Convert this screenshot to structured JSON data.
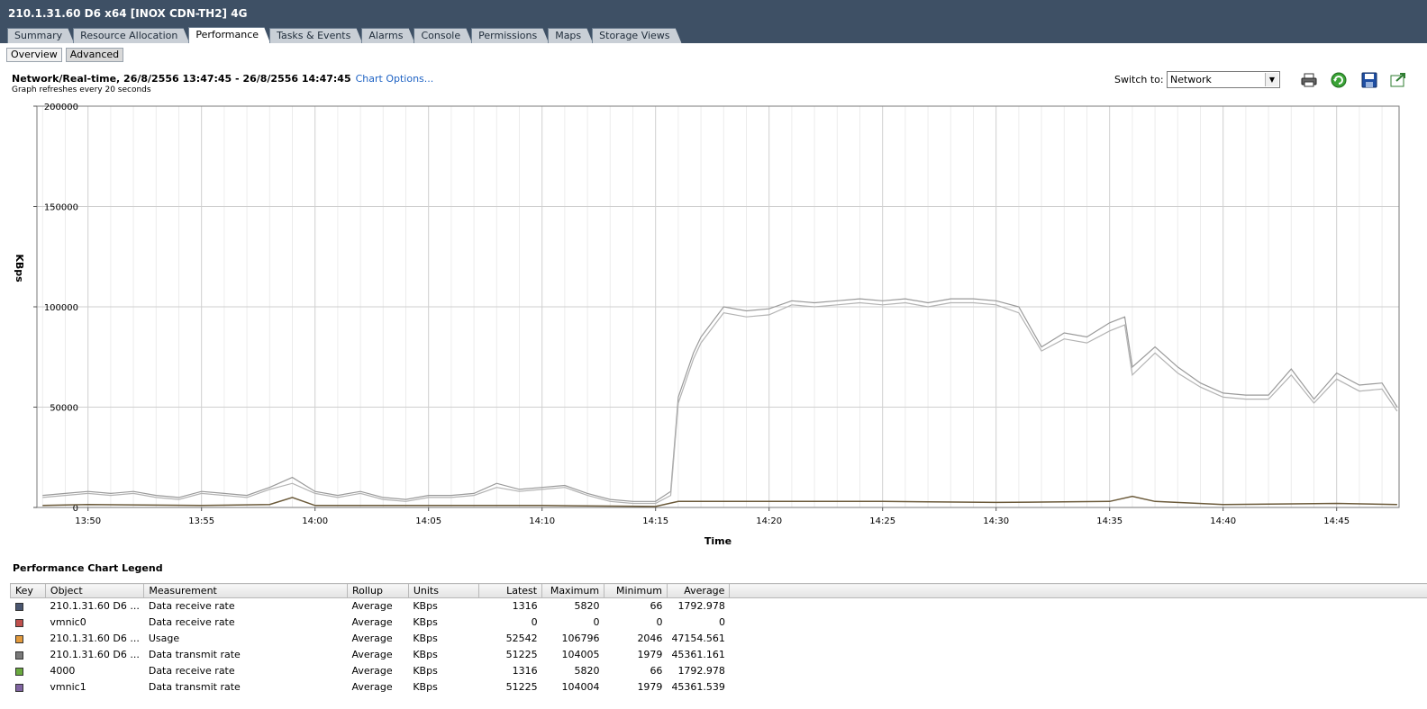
{
  "window": {
    "title": "210.1.31.60 D6 x64 [INOX CDN-TH2] 4G"
  },
  "tabs": [
    {
      "label": "Summary",
      "active": false
    },
    {
      "label": "Resource Allocation",
      "active": false
    },
    {
      "label": "Performance",
      "active": true
    },
    {
      "label": "Tasks & Events",
      "active": false
    },
    {
      "label": "Alarms",
      "active": false
    },
    {
      "label": "Console",
      "active": false
    },
    {
      "label": "Permissions",
      "active": false
    },
    {
      "label": "Maps",
      "active": false
    },
    {
      "label": "Storage Views",
      "active": false
    }
  ],
  "subtabs": {
    "overview": "Overview",
    "advanced": "Advanced"
  },
  "chart_header": {
    "title": "Network/Real-time, 26/8/2556 13:47:45 - 26/8/2556 14:47:45",
    "options_link": "Chart Options...",
    "refresh_note": "Graph refreshes every 20 seconds"
  },
  "switch_to": {
    "label": "Switch to:",
    "value": "Network"
  },
  "toolbar_icons": [
    "print-icon",
    "refresh-icon",
    "save-icon",
    "export-icon"
  ],
  "chart_data": {
    "type": "line",
    "title": "",
    "xlabel": "Time",
    "ylabel": "KBps",
    "ylim": [
      0,
      200000
    ],
    "yticks": [
      0,
      50000,
      100000,
      150000,
      200000
    ],
    "xlim": [
      "13:47:45",
      "14:47:45"
    ],
    "xticks": [
      "13:50",
      "13:55",
      "14:00",
      "14:05",
      "14:10",
      "14:15",
      "14:20",
      "14:25",
      "14:30",
      "14:35",
      "14:40",
      "14:45"
    ],
    "grid": true,
    "series": [
      {
        "color": "#9a9a9a",
        "x": [
          "13:48",
          "13:49",
          "13:50",
          "13:51",
          "13:52",
          "13:53",
          "13:54",
          "13:55",
          "13:56",
          "13:57",
          "13:58",
          "13:59",
          "14:00",
          "14:01",
          "14:02",
          "14:03",
          "14:04",
          "14:05",
          "14:06",
          "14:07",
          "14:08",
          "14:09",
          "14:10",
          "14:11",
          "14:12",
          "14:13",
          "14:14",
          "14:15",
          "14:15:40",
          "14:16",
          "14:16:40",
          "14:17",
          "14:18",
          "14:19",
          "14:20",
          "14:21",
          "14:22",
          "14:23",
          "14:24",
          "14:25",
          "14:26",
          "14:27",
          "14:28",
          "14:29",
          "14:30",
          "14:31",
          "14:32",
          "14:33",
          "14:34",
          "14:35",
          "14:35:40",
          "14:36",
          "14:37",
          "14:38",
          "14:39",
          "14:40",
          "14:41",
          "14:42",
          "14:43",
          "14:44",
          "14:45",
          "14:46",
          "14:47",
          "14:47:40"
        ],
        "values": [
          6000,
          7000,
          8000,
          7000,
          8000,
          6000,
          5000,
          8000,
          7000,
          6000,
          10000,
          15000,
          8000,
          6000,
          8000,
          5000,
          4000,
          6000,
          6000,
          7000,
          12000,
          9000,
          10000,
          11000,
          7000,
          4000,
          3000,
          3000,
          8000,
          55000,
          77000,
          85000,
          100000,
          98000,
          99000,
          103000,
          102000,
          103000,
          104000,
          103000,
          104000,
          102000,
          104000,
          104000,
          103000,
          100000,
          80000,
          87000,
          85000,
          92000,
          95000,
          70000,
          80000,
          70000,
          62000,
          57000,
          56000,
          56000,
          69000,
          54000,
          67000,
          61000,
          62000,
          50000
        ]
      },
      {
        "color": "#b3b3b3",
        "x": [
          "13:48",
          "13:49",
          "13:50",
          "13:51",
          "13:52",
          "13:53",
          "13:54",
          "13:55",
          "13:56",
          "13:57",
          "13:58",
          "13:59",
          "14:00",
          "14:01",
          "14:02",
          "14:03",
          "14:04",
          "14:05",
          "14:06",
          "14:07",
          "14:08",
          "14:09",
          "14:10",
          "14:11",
          "14:12",
          "14:13",
          "14:14",
          "14:15",
          "14:15:40",
          "14:16",
          "14:16:40",
          "14:17",
          "14:18",
          "14:19",
          "14:20",
          "14:21",
          "14:22",
          "14:23",
          "14:24",
          "14:25",
          "14:26",
          "14:27",
          "14:28",
          "14:29",
          "14:30",
          "14:31",
          "14:32",
          "14:33",
          "14:34",
          "14:35",
          "14:35:40",
          "14:36",
          "14:37",
          "14:38",
          "14:39",
          "14:40",
          "14:41",
          "14:42",
          "14:43",
          "14:44",
          "14:45",
          "14:46",
          "14:47",
          "14:47:40"
        ],
        "values": [
          5000,
          6000,
          7000,
          6000,
          7000,
          5000,
          4000,
          7000,
          6000,
          5000,
          9000,
          12000,
          7000,
          5000,
          7000,
          4000,
          3000,
          5000,
          5000,
          6000,
          10000,
          8000,
          9000,
          10000,
          6000,
          3000,
          2000,
          2000,
          6000,
          52000,
          74000,
          82000,
          97000,
          95000,
          96000,
          101000,
          100000,
          101000,
          102000,
          101000,
          102000,
          100000,
          102000,
          102000,
          101000,
          97000,
          78000,
          84000,
          82000,
          88000,
          91000,
          66000,
          77000,
          67000,
          60000,
          55000,
          54000,
          54000,
          66000,
          52000,
          64000,
          58000,
          59000,
          48000
        ]
      },
      {
        "color": "#6b5a3a",
        "x": [
          "13:48",
          "13:50",
          "13:55",
          "13:58",
          "13:59",
          "14:00",
          "14:05",
          "14:10",
          "14:15",
          "14:16",
          "14:20",
          "14:25",
          "14:30",
          "14:35",
          "14:36",
          "14:37",
          "14:40",
          "14:45",
          "14:47:40"
        ],
        "values": [
          1000,
          1500,
          1000,
          1500,
          5000,
          1000,
          1000,
          1000,
          500,
          3000,
          3000,
          3000,
          2500,
          3000,
          5500,
          3000,
          1500,
          2000,
          1500
        ]
      }
    ]
  },
  "legend": {
    "title": "Performance Chart Legend",
    "columns": [
      "Key",
      "Object",
      "Measurement",
      "Rollup",
      "Units",
      "Latest",
      "Maximum",
      "Minimum",
      "Average"
    ],
    "rows": [
      {
        "color": "#4a5670",
        "object": "210.1.31.60 D6 ...",
        "measurement": "Data receive rate",
        "rollup": "Average",
        "units": "KBps",
        "latest": "1316",
        "maximum": "5820",
        "minimum": "66",
        "average": "1792.978"
      },
      {
        "color": "#c0504d",
        "object": "vmnic0",
        "measurement": "Data receive rate",
        "rollup": "Average",
        "units": "KBps",
        "latest": "0",
        "maximum": "0",
        "minimum": "0",
        "average": "0"
      },
      {
        "color": "#e39a3c",
        "object": "210.1.31.60 D6 ...",
        "measurement": "Usage",
        "rollup": "Average",
        "units": "KBps",
        "latest": "52542",
        "maximum": "106796",
        "minimum": "2046",
        "average": "47154.561"
      },
      {
        "color": "#7a7a7a",
        "object": "210.1.31.60 D6 ...",
        "measurement": "Data transmit rate",
        "rollup": "Average",
        "units": "KBps",
        "latest": "51225",
        "maximum": "104005",
        "minimum": "1979",
        "average": "45361.161"
      },
      {
        "color": "#6aaa3f",
        "object": "4000",
        "measurement": "Data receive rate",
        "rollup": "Average",
        "units": "KBps",
        "latest": "1316",
        "maximum": "5820",
        "minimum": "66",
        "average": "1792.978"
      },
      {
        "color": "#8064a2",
        "object": "vmnic1",
        "measurement": "Data transmit rate",
        "rollup": "Average",
        "units": "KBps",
        "latest": "51225",
        "maximum": "104004",
        "minimum": "1979",
        "average": "45361.539"
      }
    ]
  }
}
